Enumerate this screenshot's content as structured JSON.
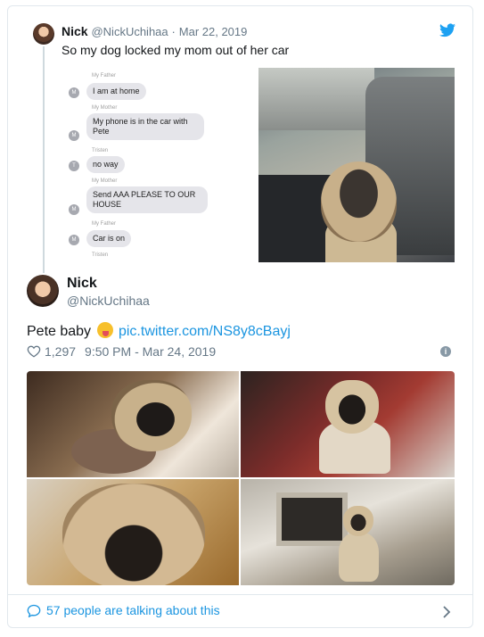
{
  "quoted_tweet": {
    "name": "Nick",
    "handle": "@NickUchihaa",
    "date": "Mar 22, 2019",
    "text": "So my dog locked my mom out of her car",
    "chat": [
      {
        "sender": "My Father",
        "avatar": "M",
        "text": "I am at home"
      },
      {
        "sender": "My Mother",
        "avatar": "M",
        "text": "My phone is in the car with Pete"
      },
      {
        "sender": "Tristen",
        "avatar": "T",
        "text": "no way"
      },
      {
        "sender": "My Mother",
        "avatar": "M",
        "text": "Send AAA PLEASE TO OUR HOUSE"
      },
      {
        "sender": "My Father",
        "avatar": "M",
        "text": "Car is on"
      },
      {
        "sender": "Tristen",
        "avatar": "",
        "text": ""
      }
    ]
  },
  "main_tweet": {
    "name": "Nick",
    "handle": "@NickUchihaa",
    "text": "Pete baby",
    "link": "pic.twitter.com/NS8y8cBayj",
    "likes": "1,297",
    "timestamp": "9:50 PM - Mar 24, 2019"
  },
  "footer": {
    "text": "57 people are talking about this"
  },
  "colors": {
    "link": "#1b95e0",
    "meta": "#657786",
    "border": "#e1e8ed"
  }
}
